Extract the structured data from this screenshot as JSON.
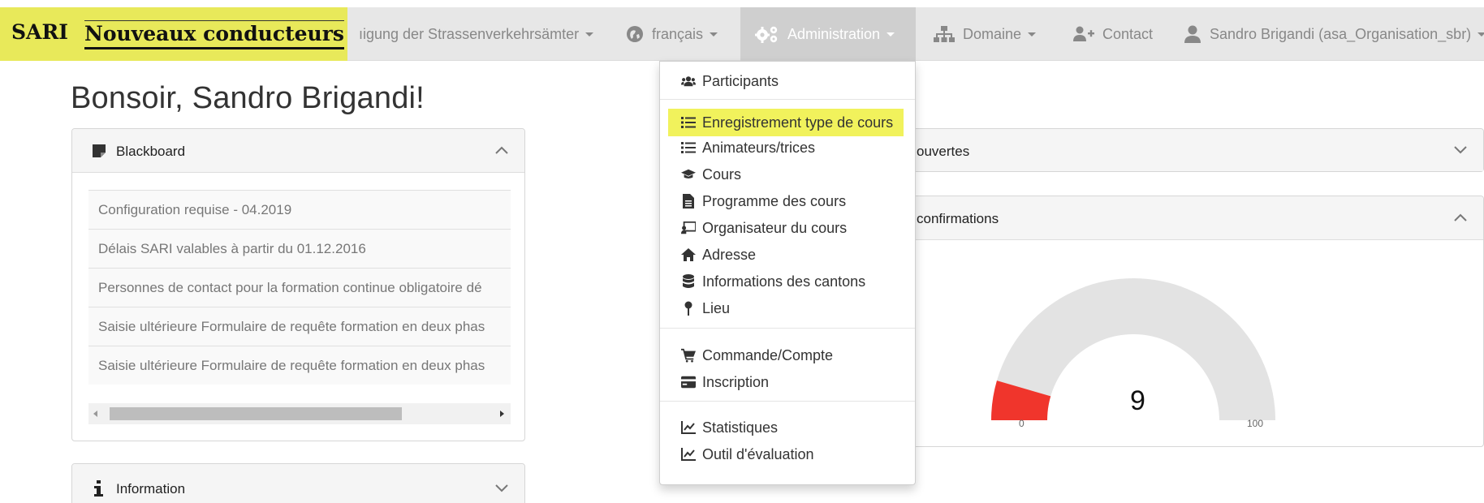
{
  "brand": {
    "short": "SARI",
    "title": "Nouveaux conducteurs"
  },
  "nav": {
    "org_label": "ıigung der Strassenverkehrsämter",
    "language": "français",
    "admin": "Administration",
    "domain": "Domaine",
    "contact": "Contact",
    "user": "Sandro Brigandi (asa_Organisation_sbr)"
  },
  "greeting": "Bonsoir, Sandro Brigandi!",
  "blackboard": {
    "title": "Blackboard",
    "items": [
      "Configuration requise - 04.2019",
      "Délais SARI valables à partir du 01.12.2016",
      "Personnes de contact pour la formation continue obligatoire dé",
      "Saisie ultérieure Formulaire de requête formation en deux phas",
      "Saisie ultérieure Formulaire de requête formation en deux phas"
    ]
  },
  "information": {
    "title": "Information"
  },
  "right_panels": {
    "panel1_title": "ouvertes",
    "panel2_title": "confirmations"
  },
  "gauge": {
    "value": "9",
    "min_label": "0",
    "max_label": "100",
    "value_fraction": 0.09,
    "fill_color": "#f0352c",
    "track_color": "#e3e3e3"
  },
  "admin_menu": {
    "items": [
      {
        "label": "Participants",
        "icon": "users-icon"
      },
      {
        "label": "Enregistrement type de cours",
        "icon": "list-icon",
        "highlighted": true
      },
      {
        "label": "Animateurs/trices",
        "icon": "list-icon"
      },
      {
        "label": "Cours",
        "icon": "graduation-cap-icon"
      },
      {
        "label": "Programme des cours",
        "icon": "file-icon"
      },
      {
        "label": "Organisateur du cours",
        "icon": "chalkboard-teacher-icon"
      },
      {
        "label": "Adresse",
        "icon": "home-icon"
      },
      {
        "label": "Informations des cantons",
        "icon": "database-icon"
      },
      {
        "label": "Lieu",
        "icon": "map-pin-icon"
      },
      {
        "label": "Commande/Compte",
        "icon": "cart-icon"
      },
      {
        "label": "Inscription",
        "icon": "credit-card-icon"
      },
      {
        "label": "Statistiques",
        "icon": "line-chart-icon"
      },
      {
        "label": "Outil d'évaluation",
        "icon": "line-chart-icon"
      }
    ]
  },
  "colors": {
    "highlight": "#f1f25c",
    "navbar": "#e7e7e7",
    "admin_active": "#cfcfcf"
  }
}
